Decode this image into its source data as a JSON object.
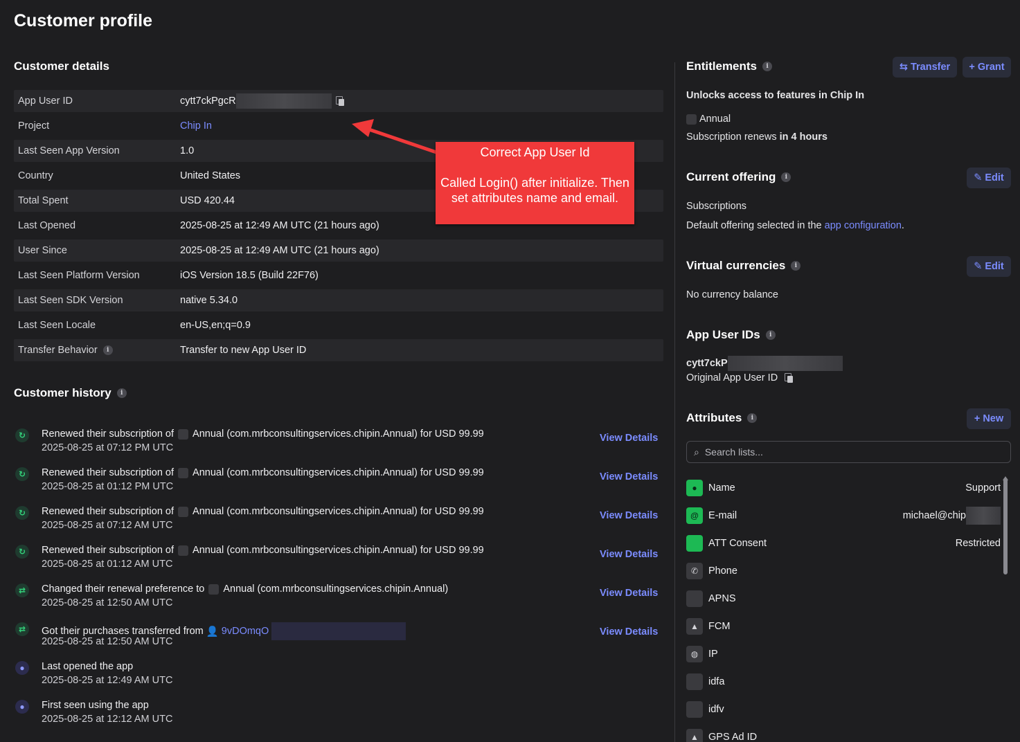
{
  "page": {
    "title": "Customer profile"
  },
  "customer_details": {
    "title": "Customer details",
    "rows": [
      {
        "label": "App User ID",
        "value": "cytt7ckPgcR"
      },
      {
        "label": "Project",
        "value": "Chip In"
      },
      {
        "label": "Last Seen App Version",
        "value": "1.0"
      },
      {
        "label": "Country",
        "value": "United States"
      },
      {
        "label": "Total Spent",
        "value": "USD 420.44"
      },
      {
        "label": "Last Opened",
        "value": "2025-08-25 at 12:49 AM UTC (21 hours ago)"
      },
      {
        "label": "User Since",
        "value": "2025-08-25 at 12:49 AM UTC (21 hours ago)"
      },
      {
        "label": "Last Seen Platform Version",
        "value": "iOS Version 18.5 (Build 22F76)"
      },
      {
        "label": "Last Seen SDK Version",
        "value": "native 5.34.0"
      },
      {
        "label": "Last Seen Locale",
        "value": "en-US,en;q=0.9"
      },
      {
        "label": "Transfer Behavior",
        "value": "Transfer to new App User ID"
      }
    ]
  },
  "callout": {
    "line1": "Correct App User Id",
    "line2": "Called Login() after initialize. Then set attributes name and email."
  },
  "customer_history": {
    "title": "Customer history",
    "view_details_label": "View Details",
    "items": [
      {
        "prefix": "Renewed their subscription of",
        "product": "Annual (com.mrbconsultingservices.chipin.Annual) for USD 99.99",
        "date": "2025-08-25 at 07:12 PM UTC"
      },
      {
        "prefix": "Renewed their subscription of",
        "product": "Annual (com.mrbconsultingservices.chipin.Annual) for USD 99.99",
        "date": "2025-08-25 at 01:12 PM UTC"
      },
      {
        "prefix": "Renewed their subscription of",
        "product": "Annual (com.mrbconsultingservices.chipin.Annual) for USD 99.99",
        "date": "2025-08-25 at 07:12 AM UTC"
      },
      {
        "prefix": "Renewed their subscription of",
        "product": "Annual (com.mrbconsultingservices.chipin.Annual) for USD 99.99",
        "date": "2025-08-25 at 01:12 AM UTC"
      },
      {
        "prefix": "Changed their renewal preference to",
        "product": "Annual (com.mrbconsultingservices.chipin.Annual)",
        "date": "2025-08-25 at 12:50 AM UTC"
      },
      {
        "prefix": "Got their purchases transferred from",
        "product": "9vDOmqO",
        "date": "2025-08-25 at 12:50 AM UTC"
      },
      {
        "prefix": "Last opened the app",
        "product": "",
        "date": "2025-08-25 at 12:49 AM UTC"
      },
      {
        "prefix": "First seen using the app",
        "product": "",
        "date": "2025-08-25 at 12:12 AM UTC"
      }
    ]
  },
  "entitlements": {
    "title": "Entitlements",
    "transfer_label": "Transfer",
    "grant_label": "+ Grant",
    "description": "Unlocks access to features in Chip In",
    "product": "Annual",
    "renews_prefix": "Subscription renews",
    "renews_value": "in 4 hours"
  },
  "current_offering": {
    "title": "Current offering",
    "edit_label": "Edit",
    "offering_link": "Subscriptions",
    "desc_prefix": "Default offering selected in the",
    "desc_link": "app configuration",
    "desc_suffix": "."
  },
  "virtual_currencies": {
    "title": "Virtual currencies",
    "edit_label": "Edit",
    "empty": "No currency balance"
  },
  "app_user_ids": {
    "title": "App User IDs",
    "id": "cytt7ckP",
    "caption": "Original App User ID"
  },
  "attributes": {
    "title": "Attributes",
    "new_label": "+ New",
    "search_placeholder": "Search lists...",
    "items": [
      {
        "name": "Name",
        "value": "Support",
        "icon": "person-icon"
      },
      {
        "name": "E-mail",
        "value": "michael@chip",
        "icon": "at-icon"
      },
      {
        "name": "ATT Consent",
        "value": "Restricted",
        "icon": "apple-icon"
      },
      {
        "name": "Phone",
        "value": "",
        "icon": "phone-icon"
      },
      {
        "name": "APNS",
        "value": "",
        "icon": "apple-icon"
      },
      {
        "name": "FCM",
        "value": "",
        "icon": "android-icon"
      },
      {
        "name": "IP",
        "value": "",
        "icon": "globe-icon"
      },
      {
        "name": "idfa",
        "value": "",
        "icon": "apple-icon"
      },
      {
        "name": "idfv",
        "value": "",
        "icon": "apple-icon"
      },
      {
        "name": "GPS Ad ID",
        "value": "",
        "icon": "android-icon"
      }
    ]
  },
  "colors": {
    "background": "#1e1e20",
    "accent": "#7b8cff",
    "callout": "#f0393a",
    "success": "#1db954"
  }
}
